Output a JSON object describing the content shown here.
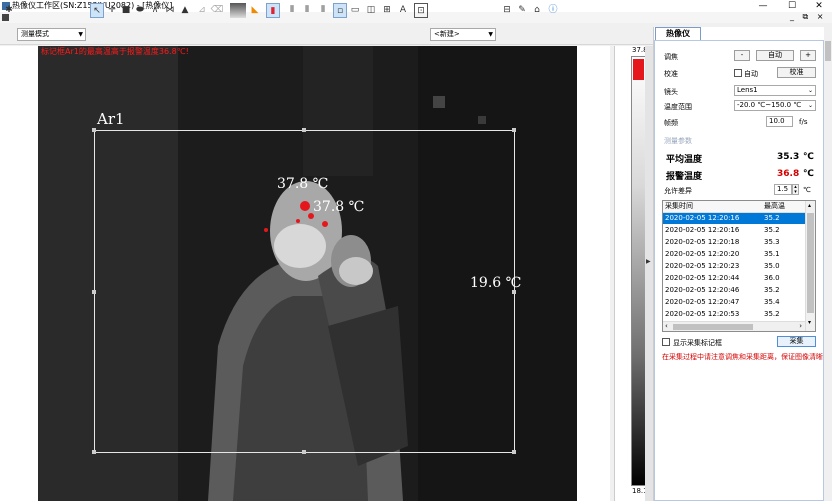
{
  "window": {
    "title": "热像仪工作区(SN:Z152JYU2082) - [热像仪]",
    "minimize": "—",
    "maximize": "☐",
    "close": "✕",
    "inner_controls": "_ ⧉ ×"
  },
  "toolbar": {
    "mode_select": "测量模式",
    "preset_select": "<新建>"
  },
  "image": {
    "alert_text": "标记框Ar1的最高温高于报警温度36.8℃!",
    "roi_label": "Ar1",
    "temp_labels": {
      "head1": "37.8 ℃",
      "head2": "37.8 ℃",
      "background": "19.6 ℃"
    }
  },
  "colorbar": {
    "max": "37.8",
    "min": "18.1"
  },
  "panel": {
    "tab": "热像仪",
    "focus_label": "调焦",
    "focus_minus": "-",
    "focus_auto": "自动",
    "focus_plus": "+",
    "calib_label": "校准",
    "auto_check_label": "自动",
    "calib_button": "校准",
    "lens_label": "镜头",
    "lens_value": "Lens1",
    "range_label": "温度范围",
    "range_value": "-20.0 ℃~150.0 ℃",
    "fps_label": "帧频",
    "fps_value": "10.0",
    "fps_unit": "f/s",
    "measure_params": "测量参数",
    "avg_label": "平均温度",
    "avg_value": "35.3",
    "avg_unit": "℃",
    "alarm_label": "报警温度",
    "alarm_value": "36.8",
    "alarm_unit": "℃",
    "diff_label": "允许差异",
    "diff_value": "1.5",
    "diff_unit": "℃",
    "list_headers": [
      "采集时间",
      "最高温"
    ],
    "list_rows": [
      [
        "2020-02-05 12:20:16",
        "35.2"
      ],
      [
        "2020-02-05 12:20:16",
        "35.2"
      ],
      [
        "2020-02-05 12:20:18",
        "35.3"
      ],
      [
        "2020-02-05 12:20:20",
        "35.1"
      ],
      [
        "2020-02-05 12:20:23",
        "35.0"
      ],
      [
        "2020-02-05 12:20:44",
        "36.0"
      ],
      [
        "2020-02-05 12:20:46",
        "35.2"
      ],
      [
        "2020-02-05 12:20:47",
        "35.4"
      ],
      [
        "2020-02-05 12:20:53",
        "35.2"
      ]
    ],
    "show_marks_label": "显示采集标记框",
    "collect_button": "采集",
    "note": "在采集过程中请注意调焦和采集距离，保证图像清晰"
  },
  "colors": {
    "alert": "#ff1a1a",
    "selection": "#0078d7",
    "hot": "#e6171c",
    "alarm_value": "#d40000"
  }
}
